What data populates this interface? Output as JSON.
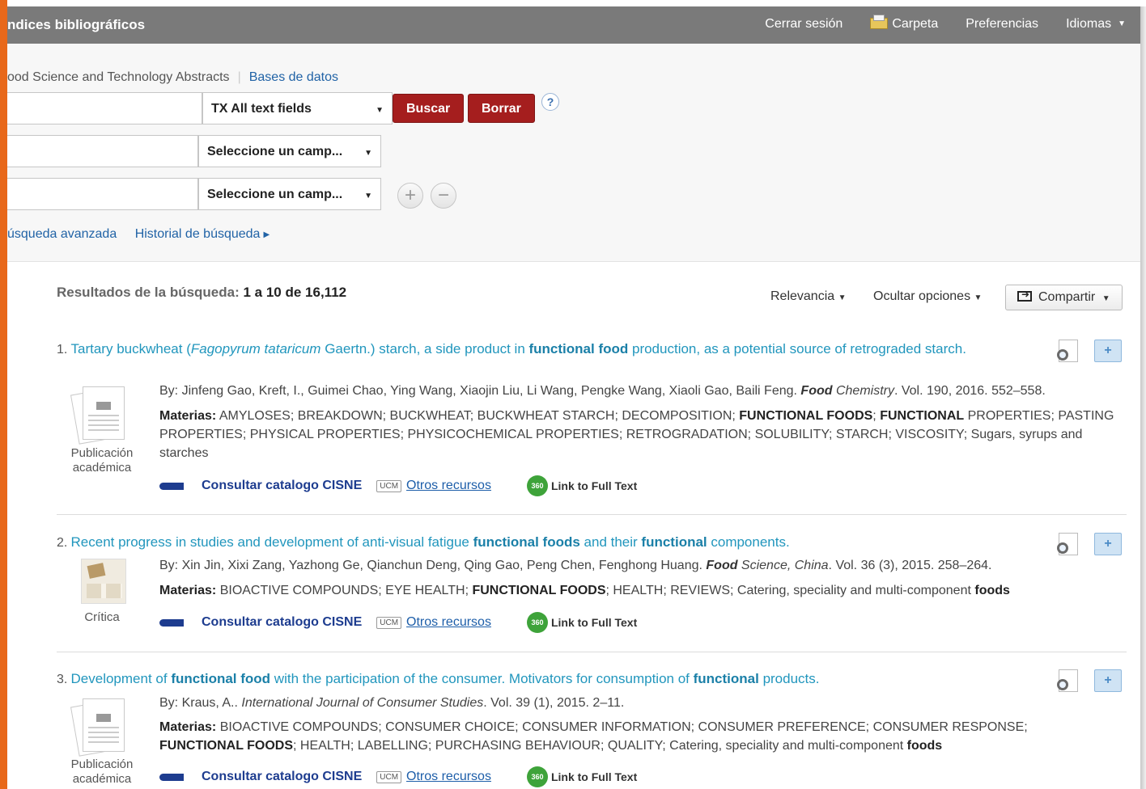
{
  "header": {
    "title": "ndices bibliográficos",
    "nav": {
      "logout": "Cerrar sesión",
      "folder": "Carpeta",
      "prefs": "Preferencias",
      "languages": "Idiomas"
    }
  },
  "search": {
    "database_name": "ood Science and Technology Abstracts",
    "databases_link": "Bases de datos",
    "field1": "TX All text fields",
    "field2": "Seleccione un camp...",
    "field3": "Seleccione un camp...",
    "search_button": "Buscar",
    "clear_button": "Borrar",
    "help": "?",
    "add": "+",
    "remove": "−",
    "advanced_link": "úsqueda avanzada",
    "history_link": "Historial de búsqueda"
  },
  "results": {
    "label": "Resultados de la búsqueda:",
    "range": "1 a 10 de 16,112",
    "sort": "Relevancia",
    "hide_options": "Ocultar opciones",
    "share": "Compartir"
  },
  "links": {
    "cisne": "Consultar catalogo CISNE",
    "ucm": "UCM",
    "otros": "Otros recursos",
    "badge": "360",
    "full_text": "Link to Full Text"
  },
  "items": [
    {
      "num": "1.",
      "title_parts": [
        "Tartary buckwheat (",
        "Fagopyrum tataricum",
        " Gaertn.) starch, a side product in ",
        "functional food",
        " production, as a potential source of retrograded starch."
      ],
      "by": "By: Jinfeng Gao, Kreft, I., Guimei Chao, Ying Wang, Xiaojin Liu, Li Wang, Pengke Wang, Xiaoli Gao, Baili Feng.",
      "journal_bold": "Food",
      "journal_rest": " Chemistry",
      "details": ". Vol. 190, 2016. 552–558.",
      "subjects_label": "Materias:",
      "subjects_1": " AMYLOSES; BREAKDOWN; BUCKWHEAT; BUCKWHEAT STARCH; DECOMPOSITION; ",
      "subjects_b1": "FUNCTIONAL FOODS",
      "subjects_2": "; ",
      "subjects_b2": "FUNCTIONAL",
      "subjects_3": " PROPERTIES; PASTING PROPERTIES; PHYSICAL PROPERTIES; PHYSICOCHEMICAL PROPERTIES; RETROGRADATION; SOLUBILITY; STARCH; VISCOSITY; Sugars, syrups and starches",
      "type_line1": "Publicación",
      "type_line2": "académica"
    },
    {
      "num": "2.",
      "title_parts": [
        "Recent progress in studies and development of anti-visual fatigue ",
        "functional foods",
        " and their ",
        "functional",
        " components."
      ],
      "by": "By: Xin Jin, Xixi Zang, Yazhong Ge, Qianchun Deng, Qing Gao, Peng Chen, Fenghong Huang.",
      "journal_bold": "Food",
      "journal_rest": " Science, China",
      "details": ". Vol. 36 (3), 2015. 258–264.",
      "subjects_label": "Materias:",
      "subjects_1": " BIOACTIVE COMPOUNDS; EYE HEALTH; ",
      "subjects_b1": "FUNCTIONAL FOODS",
      "subjects_2": "; HEALTH; REVIEWS; Catering, speciality and multi-component ",
      "subjects_b2": "foods",
      "type_line1": "Crítica"
    },
    {
      "num": "3.",
      "title_parts": [
        "Development of ",
        "functional food",
        " with the participation of the consumer. Motivators for consumption of ",
        "functional",
        " products."
      ],
      "by": "By: Kraus, A..",
      "journal": "International Journal of Consumer Studies",
      "details": ". Vol. 39 (1), 2015. 2–11.",
      "subjects_label": "Materias:",
      "subjects_1": " BIOACTIVE COMPOUNDS; CONSUMER CHOICE; CONSUMER INFORMATION; CONSUMER PREFERENCE; CONSUMER RESPONSE; ",
      "subjects_b1": "FUNCTIONAL FOODS",
      "subjects_2": "; HEALTH; LABELLING; PURCHASING BEHAVIOUR; QUALITY; Catering, speciality and multi-component ",
      "subjects_b2": "foods",
      "type_line1": "Publicación",
      "type_line2": "académica"
    }
  ]
}
